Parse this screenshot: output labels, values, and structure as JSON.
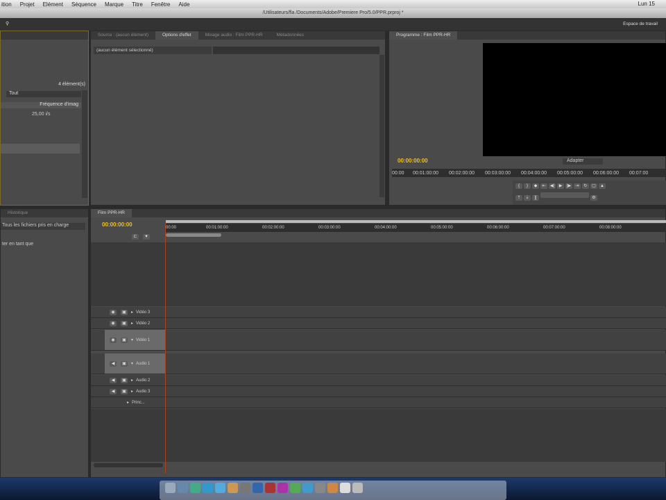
{
  "menubar": {
    "items": [
      "ition",
      "Projet",
      "Elément",
      "Séquence",
      "Marque",
      "Titre",
      "Fenêtre",
      "Aide"
    ],
    "clock": "Lun 15"
  },
  "window_title": "/Utilisateurs/fla /Documents/Adobe/Premiere Pro/5.0/PPR.prproj *",
  "toolbar": {
    "workspace_label": "Espace de travail"
  },
  "project_panel": {
    "count": "4 élément(s)",
    "filter": "Tout",
    "column": "Fréquence d'imag",
    "row_value": "25,00 i/s"
  },
  "effects_panels": {
    "tabs": [
      "Source : (aucun élément)",
      "Options d'effet",
      "Mixage audio : Film PPR-HR",
      "Métadonnées"
    ],
    "selection": "(aucun élément sélectionné)"
  },
  "program_monitor": {
    "tab": "Programme : Film PPR-HR",
    "timecode": "00:00:00:00",
    "fit": "Adapter",
    "ruler": [
      "00:00",
      "00:01:00:00",
      "00:02:00:00",
      "00:03:00:00",
      "00:04:00:00",
      "00:05:00:00",
      "00:06:00:00",
      "00:07:00"
    ]
  },
  "history_panel": {
    "tab": "Historique",
    "filter": "Tous les fichiers pris en charge",
    "option": "ter en tant que"
  },
  "timeline": {
    "tab": "Film PPR-HR",
    "timecode": "00:00:00:00",
    "ruler": [
      "00:00",
      "00:01:00:00",
      "00:02:00:00",
      "00:03:00:00",
      "00:04:00:00",
      "00:05:00:00",
      "00:06:00:00",
      "00:07:00:00",
      "00:08:00:00"
    ],
    "tracks": [
      "Vidéo 3",
      "Vidéo 2",
      "Vidéo 1",
      "Audio 1",
      "Audio 2",
      "Audio 3",
      "Princ..."
    ]
  }
}
